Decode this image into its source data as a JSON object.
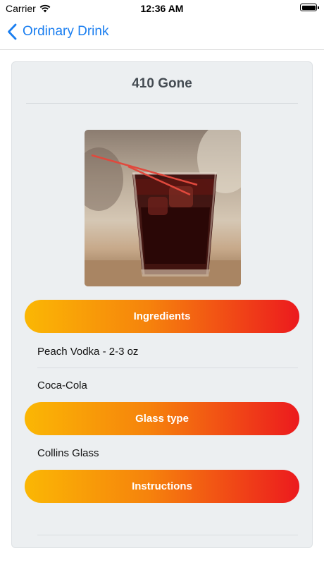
{
  "status_bar": {
    "carrier": "Carrier",
    "time": "12:36 AM"
  },
  "nav": {
    "back_label": "Ordinary Drink"
  },
  "drink": {
    "name": "410 Gone"
  },
  "sections": {
    "ingredients": {
      "title": "Ingredients",
      "items": [
        "Peach Vodka - 2-3 oz",
        "Coca-Cola"
      ]
    },
    "glass": {
      "title": "Glass type",
      "items": [
        "Collins Glass"
      ]
    },
    "instructions": {
      "title": "Instructions",
      "items": []
    }
  },
  "colors": {
    "accent_blue": "#1a7ef0",
    "gradient_start": "#fbb704",
    "gradient_mid": "#f6830c",
    "gradient_end": "#ec1a1e",
    "card_background": "#eceff1"
  },
  "icons": {
    "back": "chevron-left-icon",
    "wifi": "wifi-icon",
    "battery": "battery-icon"
  }
}
